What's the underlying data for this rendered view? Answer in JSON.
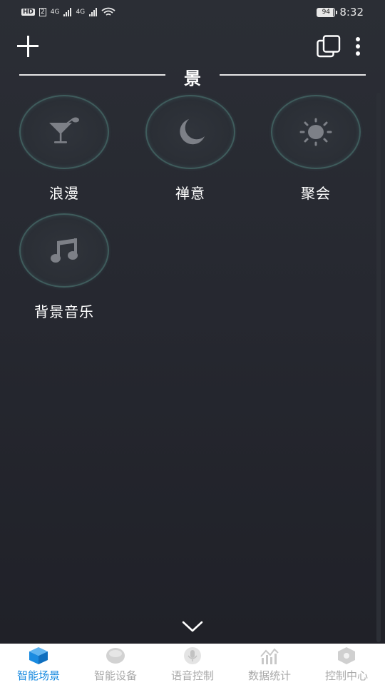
{
  "status_bar": {
    "left_badges": [
      "HD",
      "2",
      "4G",
      "4G"
    ],
    "battery": "94",
    "time": "8:32"
  },
  "toolbar": {
    "add_icon": "plus-icon",
    "windows_icon": "multi-window-icon",
    "more_icon": "more-vertical-icon"
  },
  "section": {
    "title": "景"
  },
  "scenes": [
    {
      "label": "浪漫",
      "icon": "cocktail-icon"
    },
    {
      "label": "禅意",
      "icon": "moon-icon"
    },
    {
      "label": "聚会",
      "icon": "sun-icon"
    },
    {
      "label": "背景音乐",
      "icon": "music-note-icon"
    }
  ],
  "expand_icon": "chevron-down-icon",
  "tabs": [
    {
      "label": "智能场景",
      "icon": "cube-icon",
      "active": true
    },
    {
      "label": "智能设备",
      "icon": "device-icon",
      "active": false
    },
    {
      "label": "语音控制",
      "icon": "microphone-icon",
      "active": false
    },
    {
      "label": "数据统计",
      "icon": "chart-icon",
      "active": false
    },
    {
      "label": "控制中心",
      "icon": "hexagon-icon",
      "active": false
    }
  ],
  "colors": {
    "background": "#262830",
    "circle_border": "#3f5c5c",
    "icon_gray": "#7d8087",
    "tab_active": "#1a8be0",
    "tab_inactive": "#a9a9a9"
  }
}
